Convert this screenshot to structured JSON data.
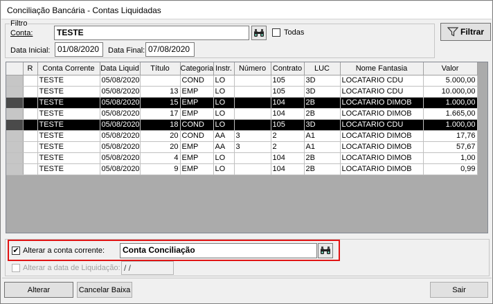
{
  "window": {
    "title": "Conciliação Bancária - Contas Liquidadas"
  },
  "filter": {
    "legend": "Filtro",
    "conta_label": "Conta:",
    "conta_value": "TESTE",
    "todas_label": "Todas",
    "todas_checked": false,
    "data_inicial_label": "Data Inicial:",
    "data_inicial_value": "01/08/2020",
    "data_final_label": "Data Final:",
    "data_final_value": "07/08/2020",
    "filtrar_label": "Filtrar"
  },
  "grid": {
    "columns": [
      "R",
      "Conta Corrente",
      "Data Liquid",
      "Título",
      "Categoria",
      "Instr.",
      "Número",
      "Contrato",
      "LUC",
      "Nome Fantasia",
      "Valor"
    ],
    "rows": [
      {
        "highlight": false,
        "cells": [
          "",
          "TESTE",
          "05/08/2020",
          "",
          "COND",
          "LO",
          "",
          "105",
          "3D",
          "LOCATARIO CDU",
          "5.000,00"
        ]
      },
      {
        "highlight": false,
        "cells": [
          "",
          "TESTE",
          "05/08/2020",
          "13",
          "EMP",
          "LO",
          "",
          "105",
          "3D",
          "LOCATARIO CDU",
          "10.000,00"
        ]
      },
      {
        "highlight": true,
        "cells": [
          "",
          "TESTE",
          "05/08/2020",
          "15",
          "EMP",
          "LO",
          "",
          "104",
          "2B",
          "LOCATARIO DIMOB",
          "1.000,00"
        ]
      },
      {
        "highlight": false,
        "cells": [
          "",
          "TESTE",
          "05/08/2020",
          "17",
          "EMP",
          "LO",
          "",
          "104",
          "2B",
          "LOCATARIO DIMOB",
          "1.665,00"
        ]
      },
      {
        "highlight": true,
        "cells": [
          "",
          "TESTE",
          "05/08/2020",
          "18",
          "COND",
          "LO",
          "",
          "105",
          "3D",
          "LOCATARIO CDU",
          "1.000,00"
        ]
      },
      {
        "highlight": false,
        "cells": [
          "",
          "TESTE",
          "05/08/2020",
          "20",
          "COND",
          "AA",
          "3",
          "2",
          "A1",
          "LOCATARIO DIMOB",
          "17,76"
        ]
      },
      {
        "highlight": false,
        "cells": [
          "",
          "TESTE",
          "05/08/2020",
          "20",
          "EMP",
          "AA",
          "3",
          "2",
          "A1",
          "LOCATARIO DIMOB",
          "57,67"
        ]
      },
      {
        "highlight": false,
        "cells": [
          "",
          "TESTE",
          "05/08/2020",
          "4",
          "EMP",
          "LO",
          "",
          "104",
          "2B",
          "LOCATARIO DIMOB",
          "1,00"
        ]
      },
      {
        "highlight": false,
        "cells": [
          "",
          "TESTE",
          "05/08/2020",
          "9",
          "EMP",
          "LO",
          "",
          "104",
          "2B",
          "LOCATARIO DIMOB",
          "0,99"
        ]
      }
    ]
  },
  "options": {
    "alterar_conta_label": "Alterar a conta corrente:",
    "alterar_conta_checked": true,
    "alterar_conta_value": "Conta Conciliação",
    "alterar_data_label": "Alterar a data de Liquidação:",
    "alterar_data_checked": false,
    "alterar_data_value": " / /"
  },
  "footer": {
    "alterar_label": "Alterar",
    "cancelar_label": "Cancelar Baixa",
    "sair_label": "Sair"
  }
}
